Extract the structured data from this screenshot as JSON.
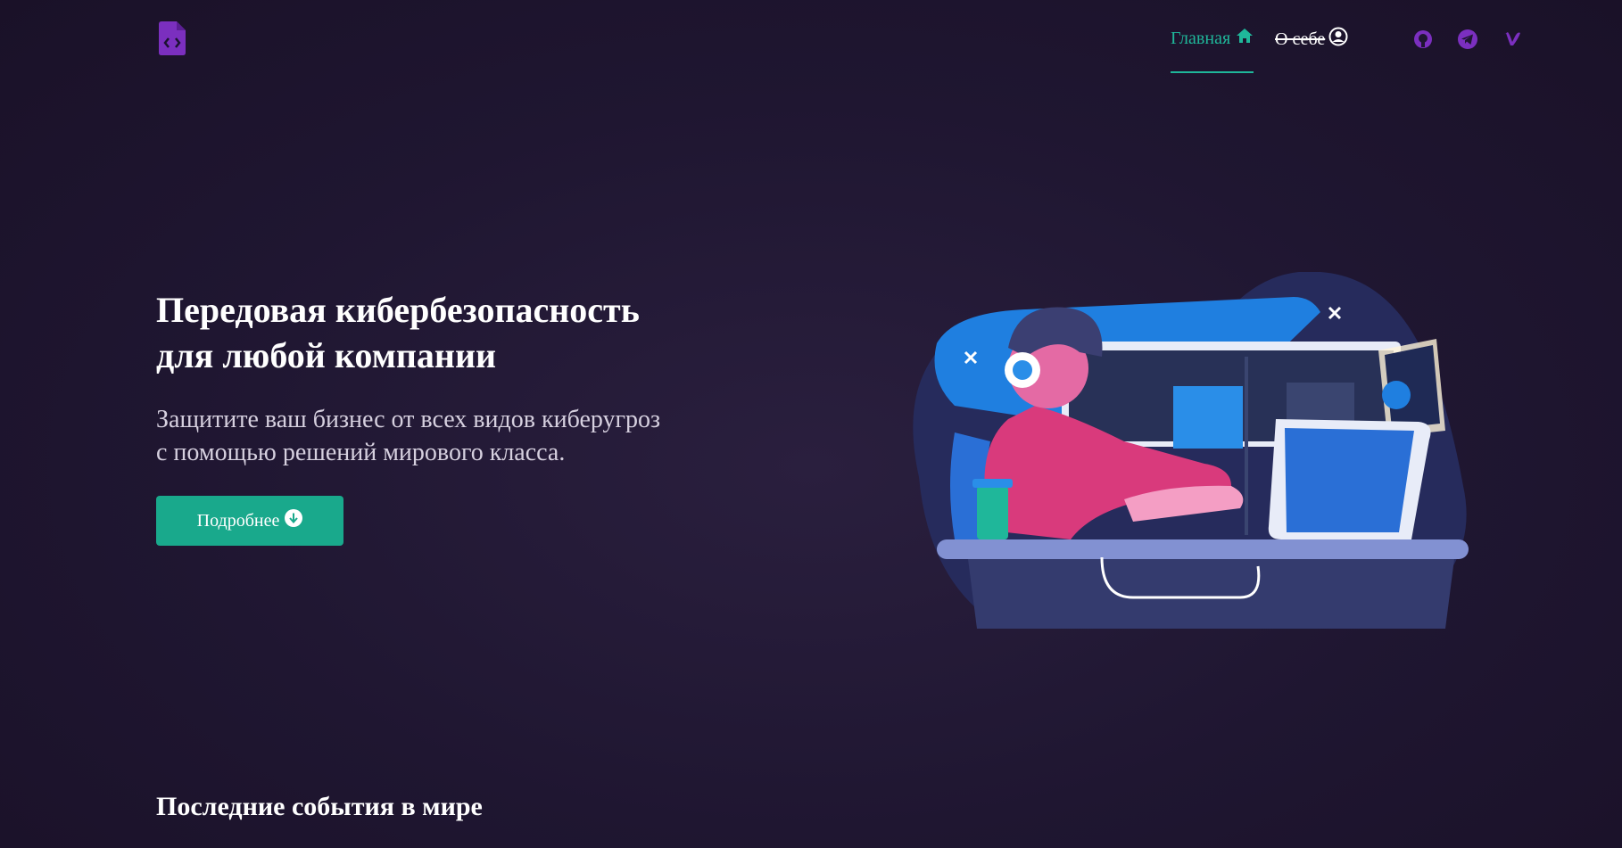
{
  "header": {
    "logo_icon": "file-code-icon",
    "nav": {
      "home_label": "Главная",
      "home_icon": "home-icon",
      "about_label": "О себе",
      "about_icon": "user-circle-icon"
    },
    "social_icons": [
      "github-icon",
      "telegram-icon",
      "vimeo-icon"
    ]
  },
  "hero": {
    "title_line1": "Передовая кибербезопасность",
    "title_line2": "для любой компании",
    "subtitle_line1": "Защитите ваш бизнес от всех видов киберугроз",
    "subtitle_line2": "с помощью решений мирового класса.",
    "button_label": "Подробнее",
    "button_icon": "arrow-down-circle-icon"
  },
  "section": {
    "title": "Последние события в мире"
  },
  "colors": {
    "accent": "#1fb79a",
    "button": "#19a98c",
    "brand_purple": "#7b2fbf",
    "background": "#1f1631"
  }
}
